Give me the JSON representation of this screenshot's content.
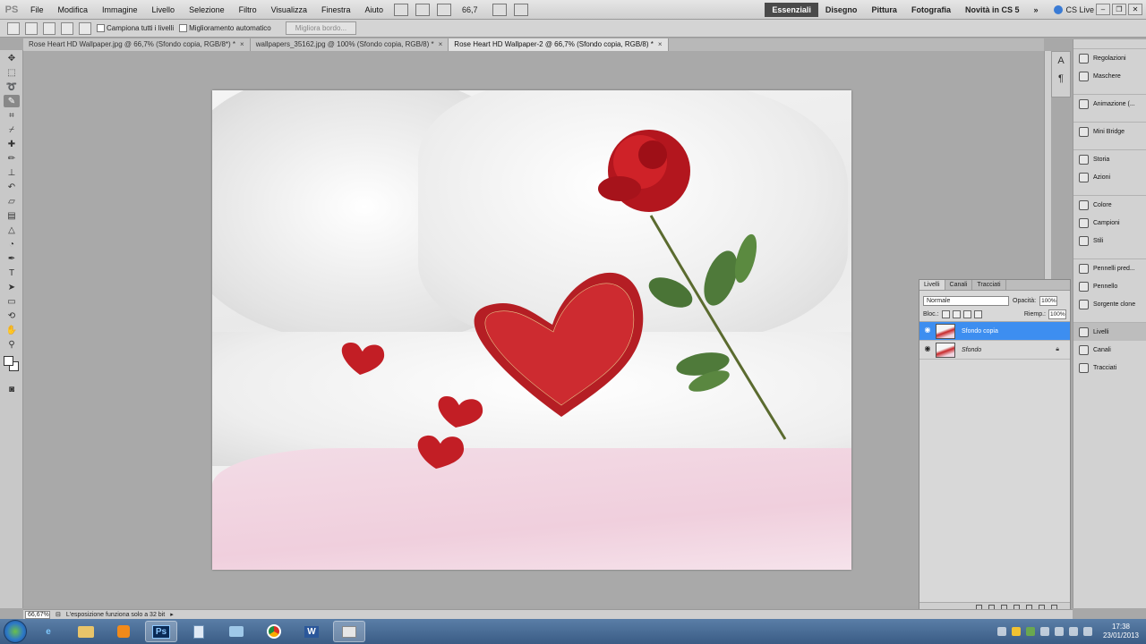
{
  "app": {
    "logo": "PS",
    "menus": [
      "File",
      "Modifica",
      "Immagine",
      "Livello",
      "Selezione",
      "Filtro",
      "Visualizza",
      "Finestra",
      "Aiuto"
    ],
    "zoom": "66,7",
    "workspaces": [
      "Essenziali",
      "Disegno",
      "Pittura",
      "Fotografia",
      "Novità in CS 5"
    ],
    "more": "»",
    "cslive": "CS Live"
  },
  "options": {
    "sample_all": "Campiona tutti i livelli",
    "auto_enhance": "Miglioramento automatico",
    "refine_edge": "Migliora bordo..."
  },
  "tabs": [
    {
      "label": "Rose Heart HD Wallpaper.jpg @ 66,7% (Sfondo copia, RGB/8*) *",
      "close": "×"
    },
    {
      "label": "wallpapers_35162.jpg @ 100% (Sfondo copia, RGB/8) *",
      "close": "×"
    },
    {
      "label": "Rose Heart HD Wallpaper-2 @ 66,7% (Sfondo copia, RGB/8) *",
      "close": "×"
    }
  ],
  "layers_panel": {
    "tabs": [
      "Livelli",
      "Canali",
      "Tracciati"
    ],
    "blend_mode": "Normale",
    "opacity_label": "Opacità:",
    "opacity": "100%",
    "lock_label": "Bloc.:",
    "fill_label": "Riemp.:",
    "fill": "100%",
    "layers": [
      {
        "name": "Sfondo copia"
      },
      {
        "name": "Sfondo"
      }
    ]
  },
  "dock": {
    "groups": [
      [
        "Regolazioni",
        "Maschere"
      ],
      [
        "Animazione (..."
      ],
      [
        "Mini Bridge"
      ],
      [
        "Storia",
        "Azioni"
      ],
      [
        "Colore",
        "Campioni",
        "Stili"
      ],
      [
        "Pennelli pred...",
        "Pennello",
        "Sorgente clone"
      ],
      [
        "Livelli",
        "Canali",
        "Tracciati"
      ]
    ]
  },
  "status": {
    "zoom": "66,67%",
    "message": "L'esposizione funziona solo a 32 bit"
  },
  "taskbar": {
    "time": "17:38",
    "date": "23/01/2013",
    "ps_label": "Ps",
    "word_label": "W"
  },
  "colors": {
    "selection": "#3d8ef0",
    "active_workspace": "#4a4a4a"
  }
}
